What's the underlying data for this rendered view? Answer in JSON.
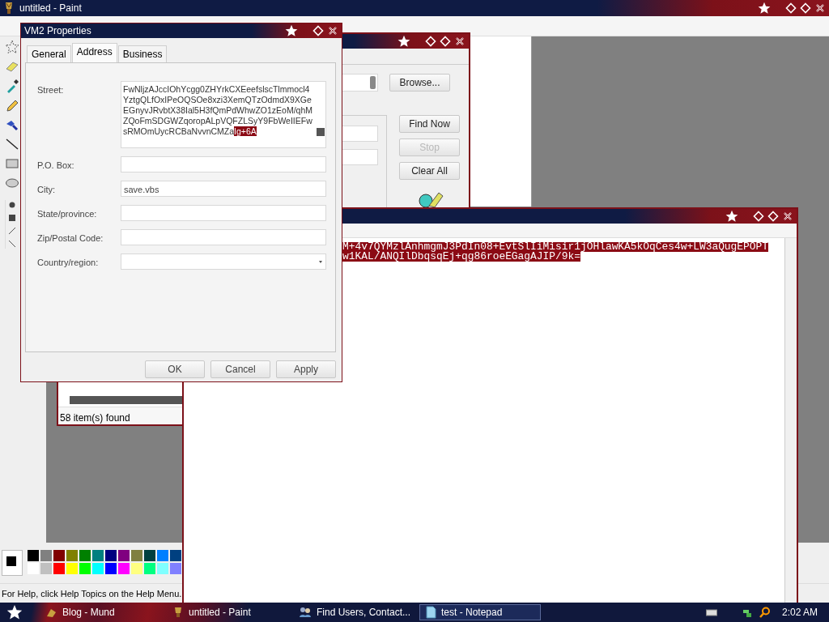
{
  "paint": {
    "title": "untitled - Paint",
    "palette": [
      {
        "color": "#000000"
      },
      {
        "color": "#808080"
      },
      {
        "color": "#800000"
      },
      {
        "color": "#808000"
      },
      {
        "color": "#008000"
      },
      {
        "color": "#008080"
      },
      {
        "color": "#000080"
      },
      {
        "color": "#800080"
      },
      {
        "color": "#808040"
      },
      {
        "color": "#004040"
      },
      {
        "color": "#0080ff"
      },
      {
        "color": "#004080"
      },
      {
        "color": "#ffffff"
      },
      {
        "color": "#c0c0c0"
      },
      {
        "color": "#ff0000"
      },
      {
        "color": "#ffff00"
      },
      {
        "color": "#00ff00"
      },
      {
        "color": "#00ffff"
      },
      {
        "color": "#0000ff"
      },
      {
        "color": "#ff00ff"
      },
      {
        "color": "#ffff80"
      },
      {
        "color": "#00ff80"
      },
      {
        "color": "#80ffff"
      },
      {
        "color": "#8080ff"
      }
    ],
    "status": "For Help, click Help Topics on the Help Menu."
  },
  "find_users": {
    "buttons": [
      {
        "label": "Browse...",
        "disabled": false
      },
      {
        "label": "Find Now",
        "disabled": false
      },
      {
        "label": "Stop",
        "disabled": true
      },
      {
        "label": "Clear All",
        "disabled": false
      }
    ],
    "status": "58 item(s) found"
  },
  "notepad": {
    "lines": [
      {
        "text": "M+4v7QYMzlAnhmgmJ3PdIn08+EvtSlIiMisir1jOHlawKA5kOqCes4w+LW3aQugEPOPT",
        "selected": true
      },
      {
        "text": "w1KAL/ANQIlDbqsqEj+qg86roeEGagAJIP/9k=",
        "selected": true
      }
    ]
  },
  "properties": {
    "title": "VM2 Properties",
    "tabs": [
      {
        "label": "General",
        "selected": false
      },
      {
        "label": "Address",
        "selected": true
      },
      {
        "label": "Business",
        "selected": false
      }
    ],
    "fields": [
      {
        "label": "Street:",
        "kind": "textarea",
        "value": "FwNljzAJccIOhYcgg0ZHYrkCXEeefslscTlmmocl4YztgQLfOxIPeOQSOe8xzi3XemQTzOdmdX9XGeEGnyvJRvbtX38Ial5H3fQmPdWhwZO1zEoM/qhMZQoFmSDGWZqoropALpVQFZLSyY9FbWeIIEFwsRMOmUycRCBaNvvnCMZa",
        "selected_text": "Ig+6A"
      },
      {
        "label": "P.O. Box:",
        "kind": "text"
      },
      {
        "label": "City:",
        "kind": "text",
        "value": "save.vbs"
      },
      {
        "label": "State/province:",
        "kind": "text"
      },
      {
        "label": "Zip/Postal Code:",
        "kind": "text"
      },
      {
        "label": "Country/region:",
        "kind": "select"
      }
    ],
    "buttons": [
      {
        "label": "OK"
      },
      {
        "label": "Cancel"
      },
      {
        "label": "Apply"
      }
    ]
  },
  "taskbar": {
    "buttons": [
      {
        "label": "Blog - Mund",
        "selected": false
      },
      {
        "label": "untitled - Paint",
        "selected": false
      },
      {
        "label": "Find Users, Contact...",
        "selected": false
      },
      {
        "label": "test - Notepad",
        "selected": true
      }
    ],
    "clock": "2:02 AM"
  }
}
